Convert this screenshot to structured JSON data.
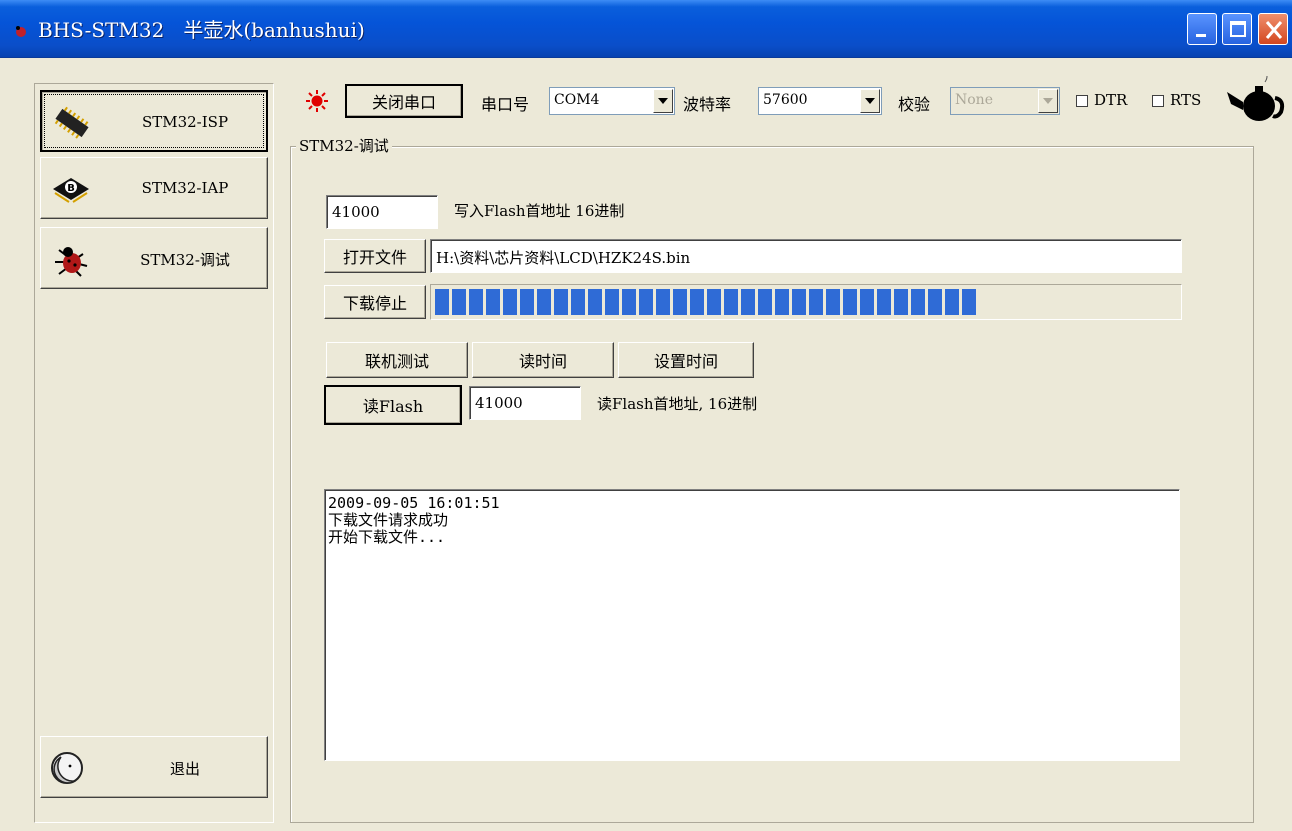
{
  "window": {
    "title": "BHS-STM32   半壶水(banhushui)",
    "controls": [
      "minimize",
      "maximize",
      "close"
    ]
  },
  "sidebar": {
    "items": [
      {
        "label": "STM32-ISP",
        "icon": "chip-icon",
        "active": true
      },
      {
        "label": "STM32-IAP",
        "icon": "chip-b-icon",
        "active": false
      },
      {
        "label": "STM32-调试",
        "icon": "bug-icon",
        "active": false
      }
    ],
    "exit": {
      "label": "退出",
      "icon": "moon-icon"
    }
  },
  "toolbar": {
    "status_icon": "red-led-icon",
    "close_port_label": "关闭串口",
    "port_label": "串口号",
    "port_value": "COM4",
    "baud_label": "波特率",
    "baud_value": "57600",
    "parity_label": "校验",
    "parity_value": "None",
    "dtr_label": "DTR",
    "dtr_checked": false,
    "rts_label": "RTS",
    "rts_checked": false,
    "logo_icon": "teapot-icon"
  },
  "debug_group": {
    "title": "STM32-调试",
    "write_address_value": "41000",
    "write_address_label": "写入Flash首地址 16进制",
    "open_file_label": "打开文件",
    "file_path": "H:\\资料\\芯片资料\\LCD\\HZK24S.bin",
    "download_stop_label": "下载停止",
    "progress_fraction": 0.73,
    "online_test_label": "联机测试",
    "read_time_label": "读时间",
    "set_time_label": "设置时间",
    "read_flash_label": "读Flash",
    "read_address_value": "41000",
    "read_address_label": "读Flash首地址, 16进制",
    "log_lines": [
      "2009-09-05 16:01:51",
      "下载文件请求成功",
      "开始下载文件..."
    ]
  },
  "colors": {
    "titlebar": "#0554d8",
    "progress": "#2f6bd6",
    "face": "#ece9d8",
    "led": "#e00000"
  }
}
